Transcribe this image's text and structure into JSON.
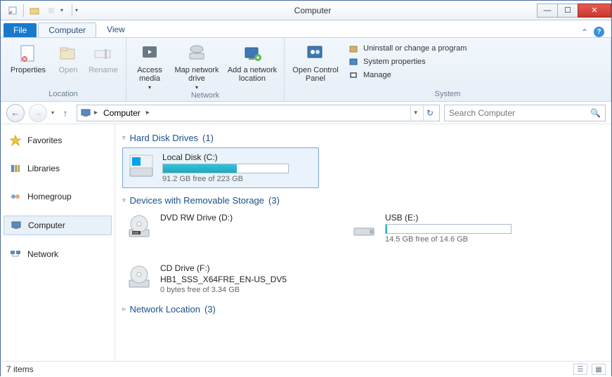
{
  "window": {
    "title": "Computer"
  },
  "tabs": {
    "file": "File",
    "computer": "Computer",
    "view": "View"
  },
  "ribbon": {
    "location": {
      "label": "Location",
      "properties": "Properties",
      "open": "Open",
      "rename": "Rename"
    },
    "network": {
      "label": "Network",
      "access_media": "Access media",
      "map_drive": "Map network drive",
      "add_location": "Add a network location"
    },
    "system": {
      "label": "System",
      "open_cp": "Open Control Panel",
      "uninstall": "Uninstall or change a program",
      "sysprops": "System properties",
      "manage": "Manage"
    }
  },
  "address": {
    "location": "Computer"
  },
  "search": {
    "placeholder": "Search Computer"
  },
  "sidebar": {
    "favorites": "Favorites",
    "libraries": "Libraries",
    "homegroup": "Homegroup",
    "computer": "Computer",
    "network": "Network"
  },
  "groups": {
    "hdd": {
      "title": "Hard Disk Drives",
      "count": "(1)"
    },
    "removable": {
      "title": "Devices with Removable Storage",
      "count": "(3)"
    },
    "netloc": {
      "title": "Network Location",
      "count": "(3)"
    }
  },
  "drives": {
    "c": {
      "name": "Local Disk (C:)",
      "free": "91.2 GB free of 223 GB",
      "fill_pct": 59
    },
    "d": {
      "name": "DVD RW Drive (D:)"
    },
    "e": {
      "name": "USB (E:)",
      "free": "14.5 GB free of 14.6 GB",
      "fill_pct": 1
    },
    "f": {
      "name": "CD Drive (F:)",
      "sub": "HB1_SSS_X64FRE_EN-US_DV5",
      "free": "0 bytes free of 3.34 GB"
    }
  },
  "status": {
    "items": "7 items"
  }
}
